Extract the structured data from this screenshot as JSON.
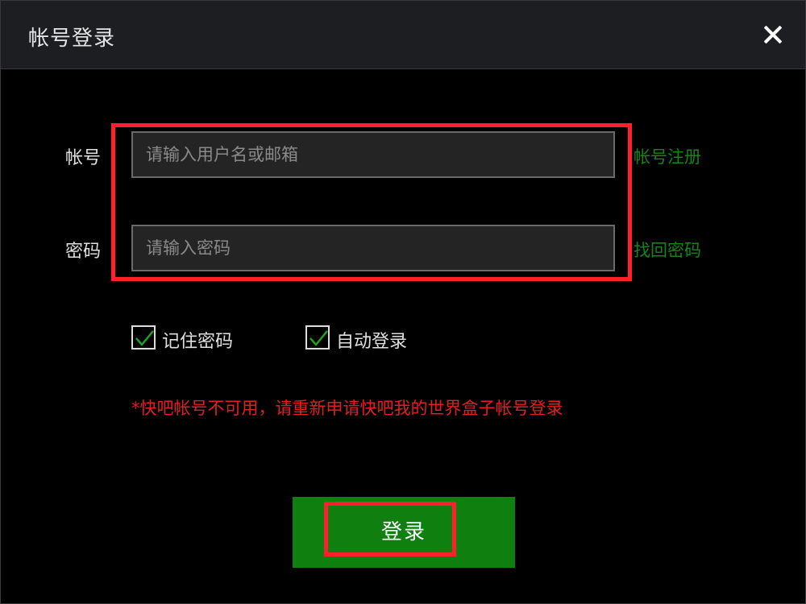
{
  "window": {
    "title": "帐号登录",
    "close_icon": "close-icon"
  },
  "form": {
    "account_label": "帐号",
    "account_placeholder": "请输入用户名或邮箱",
    "account_value": "",
    "register_link": "帐号注册",
    "password_label": "密码",
    "password_placeholder": "请输入密码",
    "password_value": "",
    "recover_link": "找回密码"
  },
  "options": {
    "remember_label": "记住密码",
    "remember_checked": true,
    "auto_login_label": "自动登录",
    "auto_login_checked": true
  },
  "warning": "*快吧帐号不可用，请重新申请快吧我的世界盒子帐号登录",
  "login_button": "登录",
  "colors": {
    "accent": "#0f7f0f",
    "link": "#17831a",
    "warning": "#e02020",
    "highlight": "#ff1f2d",
    "titlebar": "#1c1e21"
  }
}
